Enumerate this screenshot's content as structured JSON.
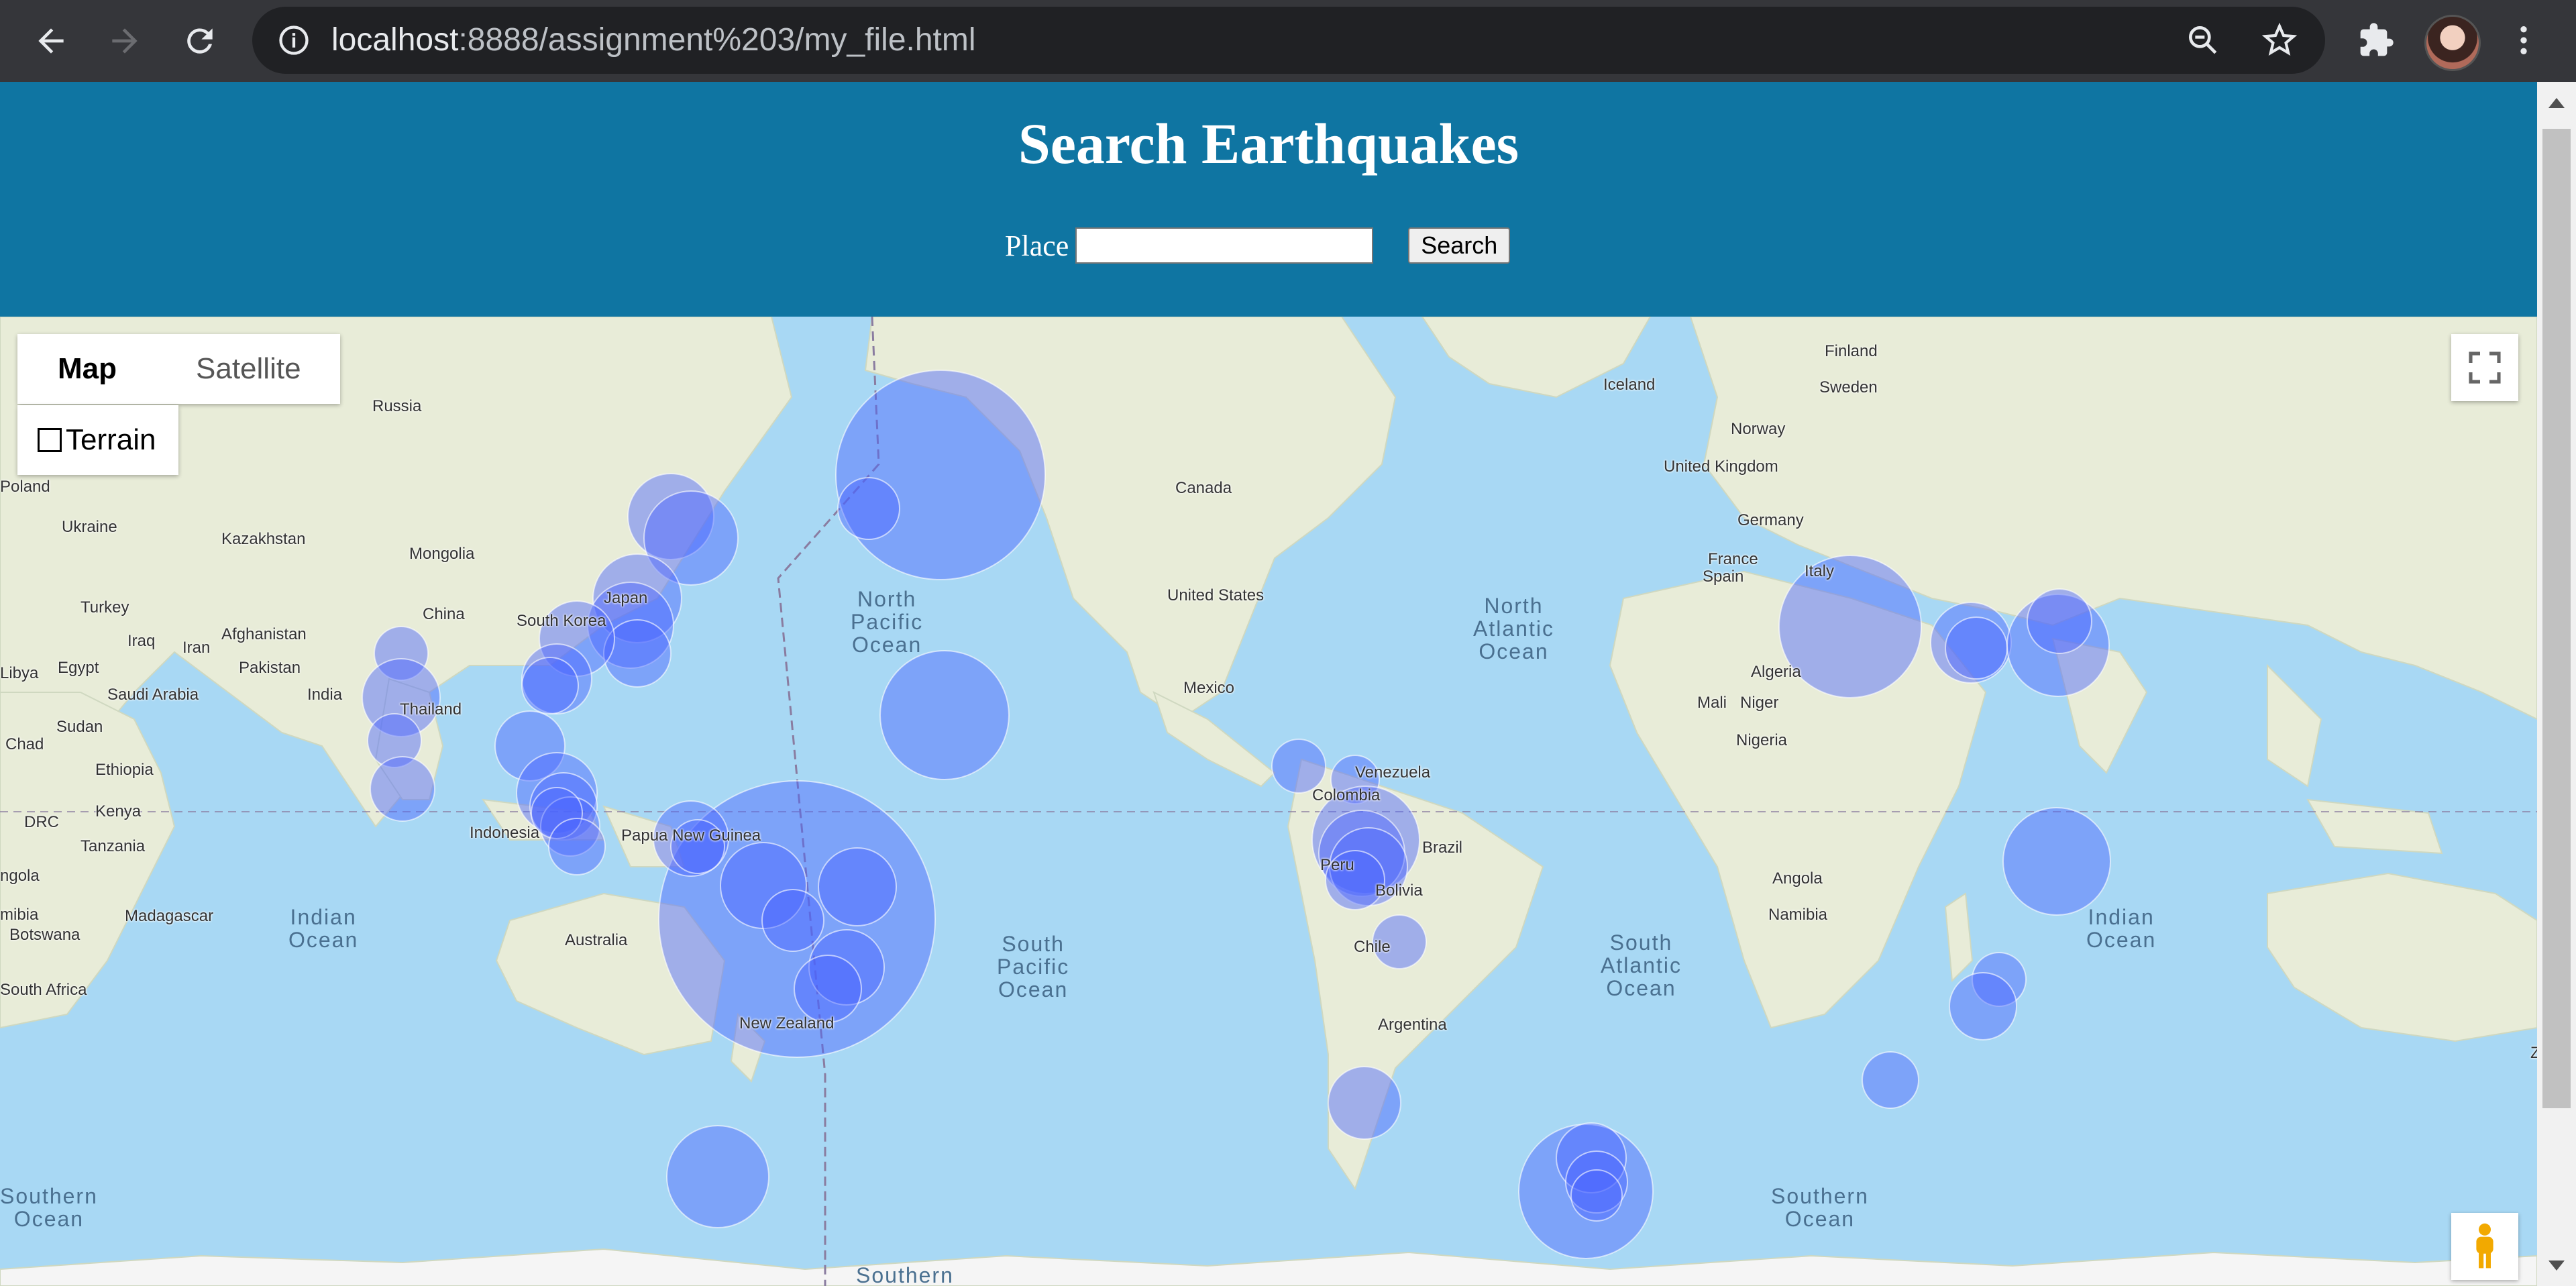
{
  "browser": {
    "url_host": "localhost",
    "url_rest": ":8888/assignment%203/my_file.html"
  },
  "page": {
    "title": "Search Earthquakes",
    "place_label": "Place",
    "place_value": "",
    "search_button": "Search"
  },
  "map": {
    "type_buttons": [
      "Map",
      "Satellite"
    ],
    "active_type": "Map",
    "terrain_label": "Terrain",
    "terrain_checked": false,
    "country_labels": [
      "Russia",
      "Poland",
      "Ukraine",
      "Kazakhstan",
      "Mongolia",
      "China",
      "Turkey",
      "Iraq",
      "Iran",
      "Afghanistan",
      "Pakistan",
      "Libya",
      "Egypt",
      "Saudi Arabia",
      "India",
      "Thailand",
      "Sudan",
      "Chad",
      "Ethiopia",
      "Kenya",
      "DRC",
      "Tanzania",
      "ngola",
      "mibia",
      "Botswana",
      "Madagascar",
      "South Africa",
      "Indonesia",
      "Papua New Guinea",
      "Australia",
      "New Zealand",
      "South Korea",
      "Japan",
      "Canada",
      "United States",
      "Mexico",
      "Venezuela",
      "Colombia",
      "Peru",
      "Brazil",
      "Bolivia",
      "Chile",
      "Argentina",
      "Iceland",
      "Finland",
      "Sweden",
      "Norway",
      "United Kingdom",
      "Germany",
      "France",
      "Spain",
      "Italy",
      "Algeria",
      "Mali",
      "Niger",
      "Nigeria",
      "Angola",
      "Namibia",
      "Ze"
    ],
    "ocean_labels": [
      "North Pacific Ocean",
      "North Atlantic Ocean",
      "South Pacific Ocean",
      "South Atlantic Ocean",
      "Indian Ocean",
      "Southern Ocean",
      "Southern"
    ],
    "colors": {
      "water": "#a8d8f4",
      "land": "#e8ecd8",
      "circle_fill": "#4a63ff",
      "header": "#0f75a2"
    }
  }
}
